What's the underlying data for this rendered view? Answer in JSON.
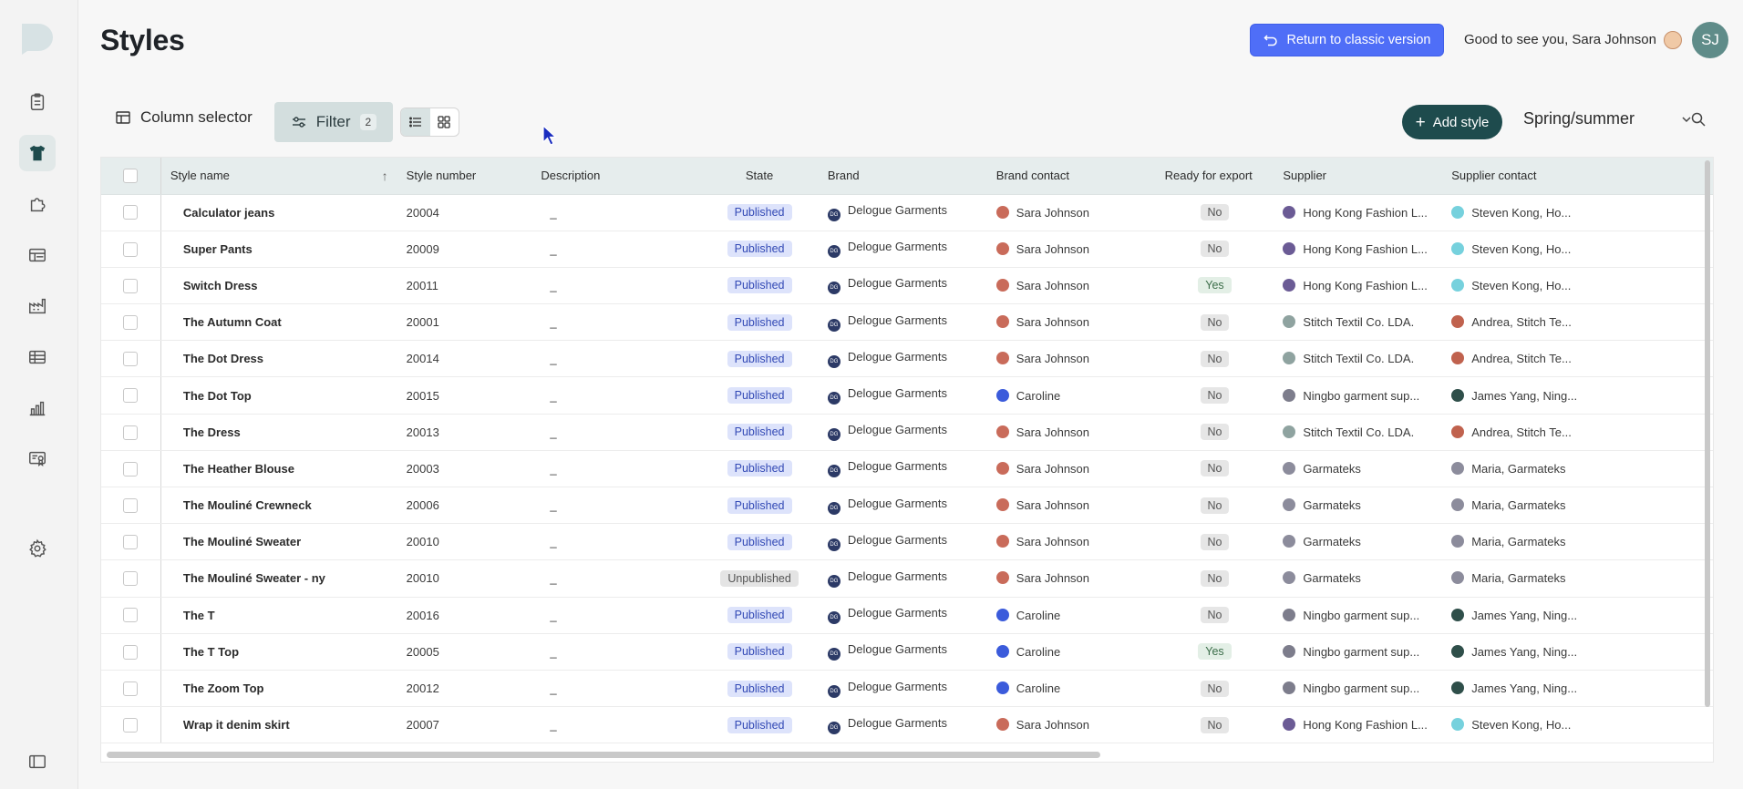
{
  "page": {
    "title": "Styles"
  },
  "header": {
    "classic_button": "Return to classic version",
    "greeting": "Good to see you, Sara Johnson",
    "avatar_initials": "SJ"
  },
  "sidebar": {
    "items": [
      {
        "icon": "clipboard-icon"
      },
      {
        "icon": "tshirt-icon",
        "active": true
      },
      {
        "icon": "puzzle-icon"
      },
      {
        "icon": "ledger-icon"
      },
      {
        "icon": "factory-icon"
      },
      {
        "icon": "table-icon"
      },
      {
        "icon": "bar-chart-icon"
      },
      {
        "icon": "certificate-icon"
      },
      {
        "icon": "gear-icon"
      }
    ]
  },
  "toolbar": {
    "column_selector": "Column selector",
    "filter_label": "Filter",
    "filter_count": "2",
    "add_style": "Add style",
    "season": "Spring/summer"
  },
  "table": {
    "columns": [
      "Style name",
      "Style number",
      "Description",
      "State",
      "Brand",
      "Brand contact",
      "Ready for export",
      "Supplier",
      "Supplier contact"
    ],
    "rows": [
      {
        "name": "Calculator jeans",
        "number": "20004",
        "desc": "_",
        "state": "Published",
        "brand": "Delogue Garments",
        "contact": "Sara Johnson",
        "ready": "No",
        "supplier": "Hong Kong Fashion L...",
        "supplier_contact": "Steven Kong, Ho..."
      },
      {
        "name": "Super Pants",
        "number": "20009",
        "desc": "_",
        "state": "Published",
        "brand": "Delogue Garments",
        "contact": "Sara Johnson",
        "ready": "No",
        "supplier": "Hong Kong Fashion L...",
        "supplier_contact": "Steven Kong, Ho..."
      },
      {
        "name": "Switch Dress",
        "number": "20011",
        "desc": "_",
        "state": "Published",
        "brand": "Delogue Garments",
        "contact": "Sara Johnson",
        "ready": "Yes",
        "supplier": "Hong Kong Fashion L...",
        "supplier_contact": "Steven Kong, Ho..."
      },
      {
        "name": "The Autumn Coat",
        "number": "20001",
        "desc": "_",
        "state": "Published",
        "brand": "Delogue Garments",
        "contact": "Sara Johnson",
        "ready": "No",
        "supplier": "Stitch Textil Co. LDA.",
        "supplier_contact": "Andrea, Stitch Te..."
      },
      {
        "name": "The Dot Dress",
        "number": "20014",
        "desc": "_",
        "state": "Published",
        "brand": "Delogue Garments",
        "contact": "Sara Johnson",
        "ready": "No",
        "supplier": "Stitch Textil Co. LDA.",
        "supplier_contact": "Andrea, Stitch Te..."
      },
      {
        "name": "The Dot Top",
        "number": "20015",
        "desc": "_",
        "state": "Published",
        "brand": "Delogue Garments",
        "contact": "Caroline",
        "ready": "No",
        "supplier": "Ningbo garment sup...",
        "supplier_contact": "James Yang, Ning..."
      },
      {
        "name": "The Dress",
        "number": "20013",
        "desc": "_",
        "state": "Published",
        "brand": "Delogue Garments",
        "contact": "Sara Johnson",
        "ready": "No",
        "supplier": "Stitch Textil Co. LDA.",
        "supplier_contact": "Andrea, Stitch Te..."
      },
      {
        "name": "The Heather Blouse",
        "number": "20003",
        "desc": "_",
        "state": "Published",
        "brand": "Delogue Garments",
        "contact": "Sara Johnson",
        "ready": "No",
        "supplier": "Garmateks",
        "supplier_contact": "Maria, Garmateks"
      },
      {
        "name": "The Mouliné Crewneck",
        "number": "20006",
        "desc": "_",
        "state": "Published",
        "brand": "Delogue Garments",
        "contact": "Sara Johnson",
        "ready": "No",
        "supplier": "Garmateks",
        "supplier_contact": "Maria, Garmateks"
      },
      {
        "name": "The Mouliné Sweater",
        "number": "20010",
        "desc": "_",
        "state": "Published",
        "brand": "Delogue Garments",
        "contact": "Sara Johnson",
        "ready": "No",
        "supplier": "Garmateks",
        "supplier_contact": "Maria, Garmateks"
      },
      {
        "name": "The Mouliné Sweater - ny",
        "number": "20010",
        "desc": "_",
        "state": "Unpublished",
        "brand": "Delogue Garments",
        "contact": "Sara Johnson",
        "ready": "No",
        "supplier": "Garmateks",
        "supplier_contact": "Maria, Garmateks"
      },
      {
        "name": "The T",
        "number": "20016",
        "desc": "_",
        "state": "Published",
        "brand": "Delogue Garments",
        "contact": "Caroline",
        "ready": "No",
        "supplier": "Ningbo garment sup...",
        "supplier_contact": "James Yang, Ning..."
      },
      {
        "name": "The T Top",
        "number": "20005",
        "desc": "_",
        "state": "Published",
        "brand": "Delogue Garments",
        "contact": "Caroline",
        "ready": "Yes",
        "supplier": "Ningbo garment sup...",
        "supplier_contact": "James Yang, Ning..."
      },
      {
        "name": "The Zoom Top",
        "number": "20012",
        "desc": "_",
        "state": "Published",
        "brand": "Delogue Garments",
        "contact": "Caroline",
        "ready": "No",
        "supplier": "Ningbo garment sup...",
        "supplier_contact": "James Yang, Ning..."
      },
      {
        "name": "Wrap it denim skirt",
        "number": "20007",
        "desc": "_",
        "state": "Published",
        "brand": "Delogue Garments",
        "contact": "Sara Johnson",
        "ready": "No",
        "supplier": "Hong Kong Fashion L...",
        "supplier_contact": "Steven Kong, Ho..."
      }
    ]
  },
  "colors": {
    "primary_button": "#4f6ef7",
    "add_button": "#1e4b4d",
    "published_badge": "#dde3fb",
    "header_row": "#e6eded",
    "chat_button": "#3c6ff5"
  }
}
